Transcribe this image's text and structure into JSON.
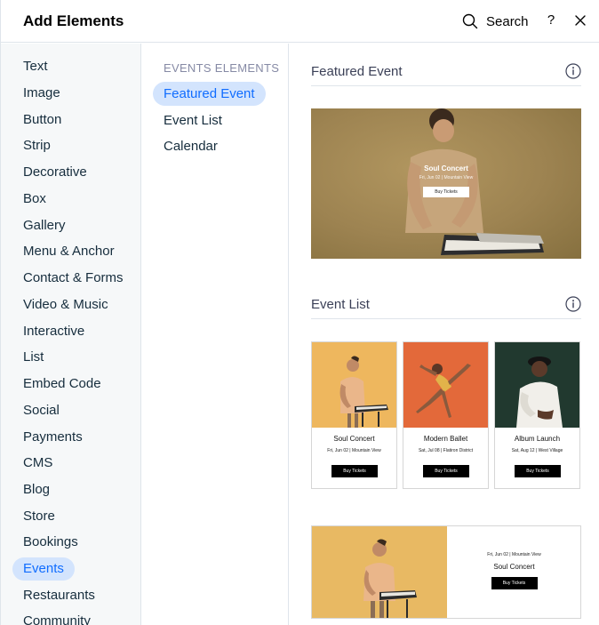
{
  "header": {
    "title": "Add Elements",
    "search_label": "Search",
    "help_label": "?"
  },
  "categories": [
    {
      "label": "Text"
    },
    {
      "label": "Image"
    },
    {
      "label": "Button"
    },
    {
      "label": "Strip"
    },
    {
      "label": "Decorative"
    },
    {
      "label": "Box"
    },
    {
      "label": "Gallery"
    },
    {
      "label": "Menu & Anchor"
    },
    {
      "label": "Contact & Forms"
    },
    {
      "label": "Video & Music"
    },
    {
      "label": "Interactive"
    },
    {
      "label": "List"
    },
    {
      "label": "Embed Code"
    },
    {
      "label": "Social"
    },
    {
      "label": "Payments"
    },
    {
      "label": "CMS"
    },
    {
      "label": "Blog"
    },
    {
      "label": "Store"
    },
    {
      "label": "Bookings"
    },
    {
      "label": "Events",
      "active": true
    },
    {
      "label": "Restaurants"
    },
    {
      "label": "Community"
    }
  ],
  "subcategories": {
    "title": "EVENTS ELEMENTS",
    "items": [
      {
        "label": "Featured Event",
        "active": true
      },
      {
        "label": "Event List"
      },
      {
        "label": "Calendar"
      }
    ]
  },
  "sections": {
    "featured": {
      "heading": "Featured Event",
      "preview": {
        "title": "Soul Concert",
        "subtitle": "Fri, Jun 02 | Mountain View",
        "button": "Buy Tickets"
      }
    },
    "event_list": {
      "heading": "Event List",
      "cards": [
        {
          "title": "Soul Concert",
          "subtitle": "Fri, Jun 02  |  Mountain View",
          "button": "Buy Tickets"
        },
        {
          "title": "Modern Ballet",
          "subtitle": "Sat, Jul 08  |  Flatiron District",
          "button": "Buy Tickets"
        },
        {
          "title": "Album Launch",
          "subtitle": "Sat, Aug 12  |  West Village",
          "button": "Buy Tickets"
        }
      ],
      "split": {
        "subtitle": "Fri, Jun 02  |  Mountain View",
        "title": "Soul Concert",
        "button": "Buy Tickets"
      }
    }
  },
  "colors": {
    "accent": "#116dff",
    "active_bg": "#d3e4fd",
    "sidebar_bg": "#f6f8f9",
    "divider": "#dfe5eb"
  },
  "icons": {
    "search": "search-icon",
    "help": "help-icon",
    "close": "close-icon",
    "info": "info-icon"
  }
}
